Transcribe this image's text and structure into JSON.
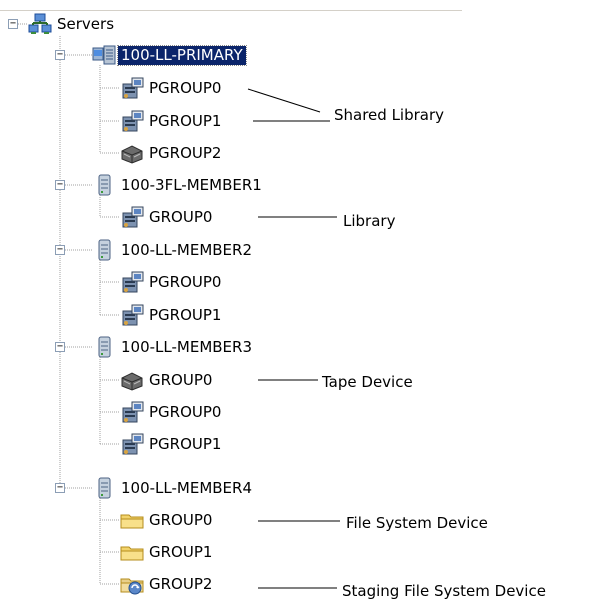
{
  "tree": {
    "root": {
      "label": "Servers",
      "icon": "network-servers-icon"
    },
    "servers": [
      {
        "name": "100-LL-PRIMARY",
        "selected": true,
        "icon": "primary-server-icon",
        "groups": [
          {
            "label": "PGROUP0",
            "icon": "library-icon"
          },
          {
            "label": "PGROUP1",
            "icon": "library-icon"
          },
          {
            "label": "PGROUP2",
            "icon": "tape-drive-icon"
          }
        ]
      },
      {
        "name": "100-3FL-MEMBER1",
        "selected": false,
        "icon": "member-server-icon",
        "groups": [
          {
            "label": "GROUP0",
            "icon": "library-icon"
          }
        ]
      },
      {
        "name": "100-LL-MEMBER2",
        "selected": false,
        "icon": "member-server-icon",
        "groups": [
          {
            "label": "PGROUP0",
            "icon": "library-icon"
          },
          {
            "label": "PGROUP1",
            "icon": "library-icon"
          }
        ]
      },
      {
        "name": "100-LL-MEMBER3",
        "selected": false,
        "icon": "member-server-icon",
        "groups": [
          {
            "label": "GROUP0",
            "icon": "tape-drive-icon"
          },
          {
            "label": "PGROUP0",
            "icon": "library-icon"
          },
          {
            "label": "PGROUP1",
            "icon": "library-icon"
          }
        ]
      },
      {
        "name": "100-LL-MEMBER4",
        "selected": false,
        "icon": "member-server-icon",
        "groups": [
          {
            "label": "GROUP0",
            "icon": "folder-icon"
          },
          {
            "label": "GROUP1",
            "icon": "folder-icon"
          },
          {
            "label": "GROUP2",
            "icon": "staging-folder-icon"
          }
        ]
      }
    ]
  },
  "annotations": {
    "shared_library": "Shared Library",
    "library": "Library",
    "tape_device": "Tape Device",
    "file_system_device": "File System Device",
    "staging_file_system_device": "Staging File System Device"
  },
  "colors": {
    "selection_bg": "#0a246a",
    "selection_text": "#ffffff",
    "tree_lines": "#a0a0a0",
    "expander_border": "#8c9eb5"
  }
}
